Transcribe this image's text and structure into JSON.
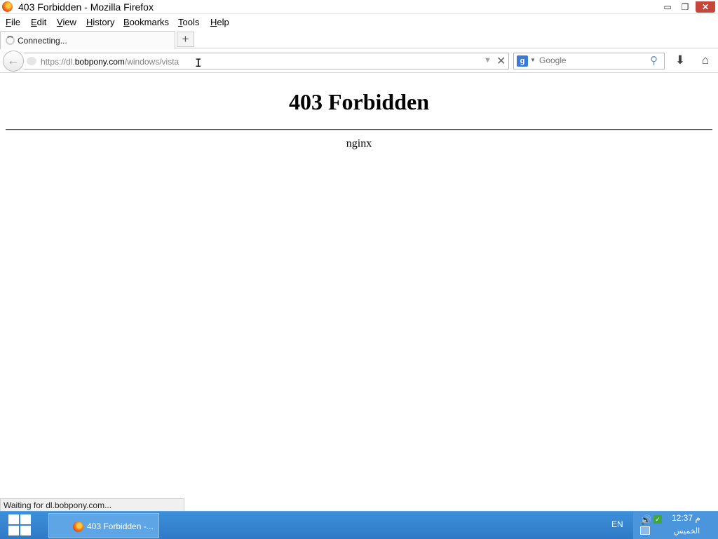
{
  "window": {
    "title": "403 Forbidden - Mozilla Firefox",
    "min_glyph": "▭",
    "max_glyph": "❐",
    "close_glyph": "✕"
  },
  "menu": {
    "file": "File",
    "edit": "Edit",
    "view": "View",
    "history": "History",
    "bookmarks": "Bookmarks",
    "tools": "Tools",
    "help": "Help"
  },
  "tab": {
    "label": "Connecting...",
    "new_tab_glyph": "+"
  },
  "nav": {
    "back_glyph": "←",
    "url_prefix": "https://dl.",
    "url_host": "bobpony.com",
    "url_path": "/windows/vista",
    "dropdown_glyph": "▼",
    "clear_glyph": "✕",
    "search_engine_glyph": "g",
    "search_placeholder": "Google",
    "search_go_glyph": "⚲",
    "download_glyph": "⬇",
    "home_glyph": "⌂",
    "cursor_glyph": "I"
  },
  "page": {
    "heading": "403 Forbidden",
    "server": "nginx"
  },
  "status": {
    "text": "Waiting for dl.bobpony.com..."
  },
  "taskbar": {
    "task_label": "403 Forbidden -...",
    "language": "EN",
    "speaker_glyph": "🔊",
    "shield_glyph": "✓",
    "time": "12:37 م",
    "day": "الخميس"
  },
  "colors": {
    "taskbar": "#2f7ac6",
    "close_button": "#c7463b"
  }
}
